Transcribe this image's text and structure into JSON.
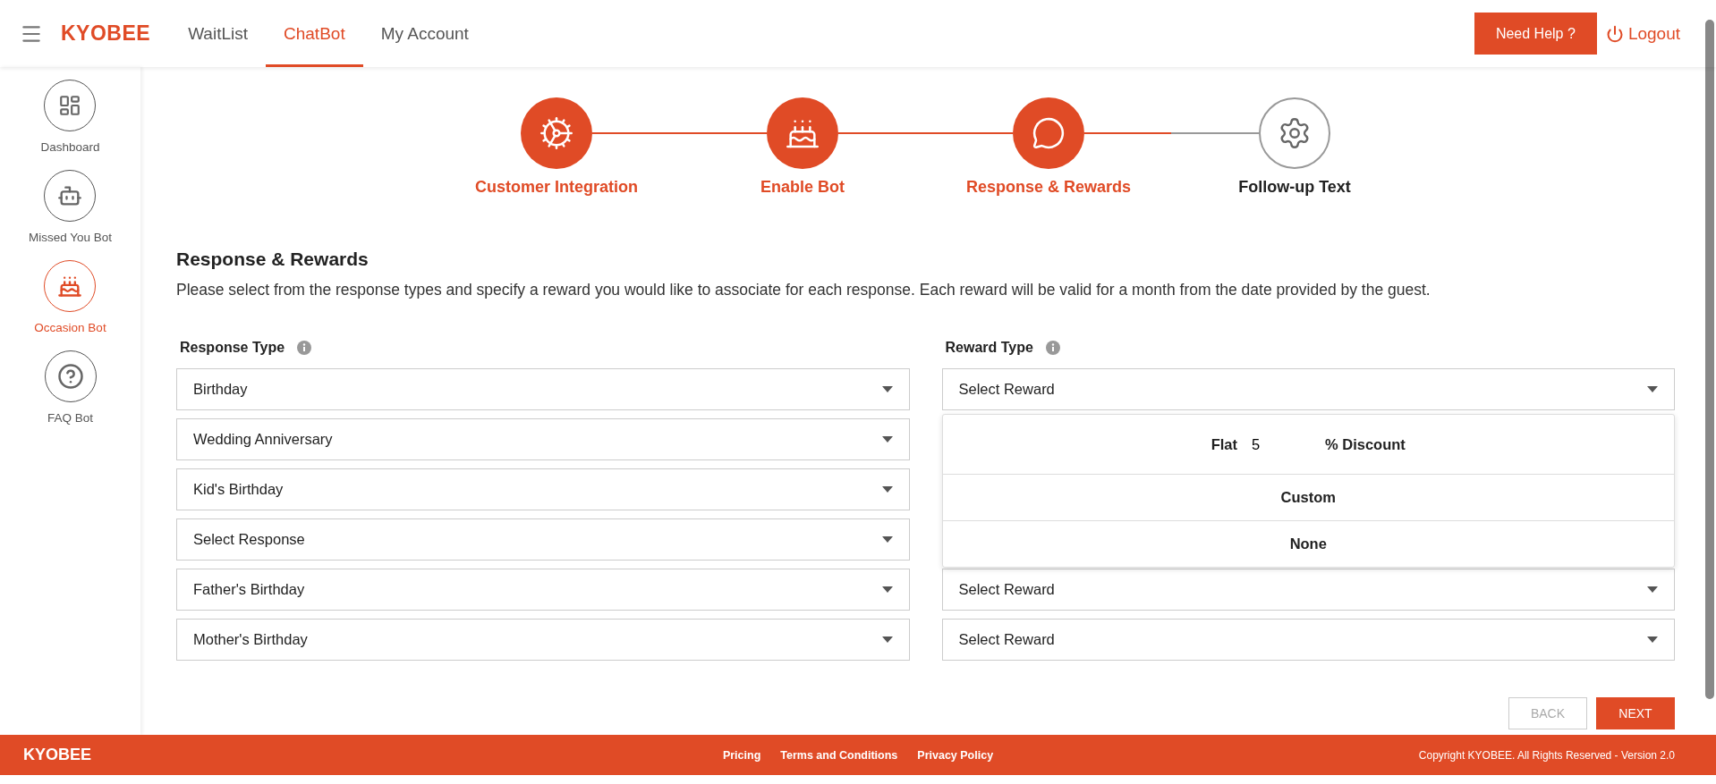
{
  "header": {
    "logo": "KYOBEE",
    "nav": [
      {
        "label": "WaitList",
        "selected": false
      },
      {
        "label": "ChatBot",
        "selected": true
      },
      {
        "label": "My Account",
        "selected": false
      }
    ],
    "help_button": "Need Help ?",
    "logout": "Logout"
  },
  "sidebar": {
    "items": [
      {
        "label": "Dashboard",
        "kind": "dashboard",
        "selected": false
      },
      {
        "label": "Missed You Bot",
        "kind": "robot",
        "selected": false
      },
      {
        "label": "Occasion Bot",
        "kind": "cake",
        "selected": true
      },
      {
        "label": "FAQ Bot",
        "kind": "question",
        "selected": false
      }
    ]
  },
  "stepper": [
    {
      "label": "Customer Integration",
      "kind": "integration",
      "completed": true
    },
    {
      "label": "Enable Bot",
      "kind": "cake",
      "completed": true
    },
    {
      "label": "Response & Rewards",
      "kind": "reply",
      "completed": true
    },
    {
      "label": "Follow-up Text",
      "kind": "settings",
      "completed": false
    }
  ],
  "section": {
    "title": "Response & Rewards",
    "description": "Please select from the response types and specify a reward you would like to associate for each response. Each reward will be valid for a month from the date provided by the guest.",
    "response_label": "Response Type",
    "reward_label": "Reward Type",
    "rows": [
      {
        "response": "Birthday",
        "reward": "Select Reward",
        "reward_menu": {
          "expanded": true,
          "options": [
            {
              "kind": "input",
              "prefix": "Flat",
              "value": "5",
              "suffix": "% Discount"
            },
            {
              "kind": "plain",
              "label": "Custom"
            },
            {
              "kind": "plain",
              "label": "None"
            }
          ]
        }
      },
      {
        "response": "Wedding Anniversary"
      },
      {
        "response": "Kid's Birthday"
      },
      {
        "response": "Select Response"
      },
      {
        "response": "Father's Birthday",
        "reward": "Select Reward"
      },
      {
        "response": "Mother's Birthday",
        "reward": "Select Reward"
      }
    ],
    "back_button": "BACK",
    "next_button": "NEXT"
  },
  "footer": {
    "logo": "KYOBEE",
    "links": [
      "Pricing",
      "Terms and Conditions",
      "Privacy Policy"
    ],
    "copyright": "Copyright KYOBEE. All Rights Reserved - Version 2.0"
  }
}
